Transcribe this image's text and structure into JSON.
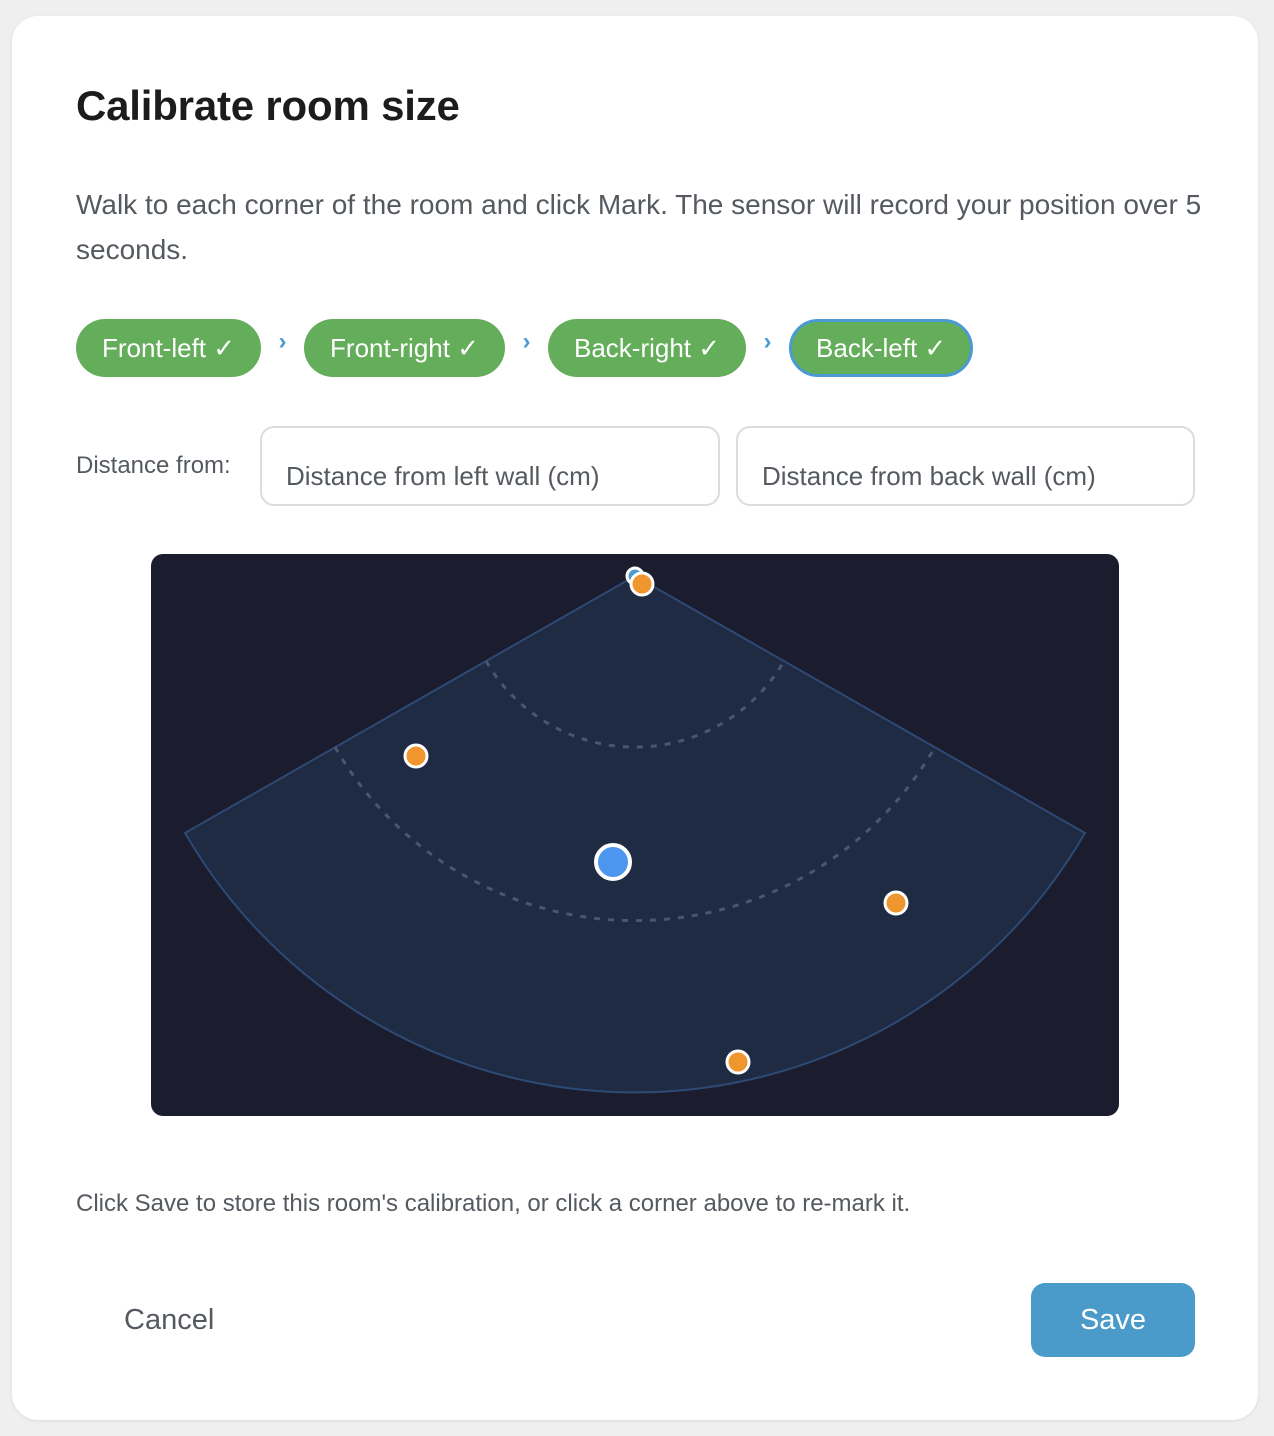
{
  "dialog": {
    "title": "Calibrate room size",
    "description": "Walk to each corner of the room and click Mark. The sensor will record your position over 5 seconds."
  },
  "steps": [
    {
      "label": "Front-left ✓",
      "status": "done",
      "active": false
    },
    {
      "label": "Front-right ✓",
      "status": "done",
      "active": false
    },
    {
      "label": "Back-right ✓",
      "status": "done",
      "active": false
    },
    {
      "label": "Back-left ✓",
      "status": "done",
      "active": true
    }
  ],
  "step_separator": "›",
  "distance": {
    "label": "Distance from:",
    "left_placeholder": "Distance from left wall (cm)",
    "back_placeholder": "Distance from back wall (cm)"
  },
  "radar": {
    "background_color": "#1b1c2d",
    "field_color": "#1f2a43",
    "field_stroke": "#2c4a74",
    "marker_color": "#f0962f",
    "user_color": "#4d96ef",
    "sensor_color": "#4a9bd1",
    "range_rings": 2,
    "markers": [
      "front-left",
      "front-right",
      "back-right",
      "back-left"
    ]
  },
  "hint": "Click Save to store this room's calibration, or click a corner above to re-mark it.",
  "actions": {
    "cancel_label": "Cancel",
    "save_label": "Save"
  },
  "colors": {
    "step_done": "#64ad5a",
    "step_active_border": "#4a9bd1",
    "save_button": "#4a9bc9"
  }
}
